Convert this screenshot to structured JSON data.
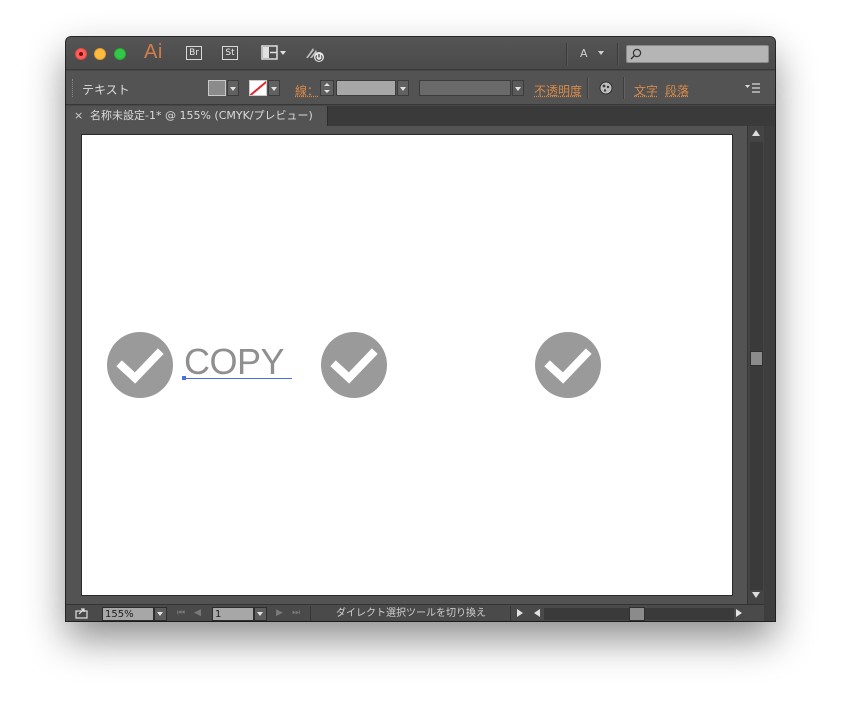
{
  "app": {
    "logo": "Ai",
    "bridge_label": "Br",
    "stock_label": "St",
    "workspace_label": "A",
    "search": {
      "value": "",
      "placeholder": ""
    }
  },
  "control_bar": {
    "selection_label": "テキスト",
    "stroke_label": "線：",
    "opacity_label": "不透明度",
    "character_label": "文字",
    "paragraph_label": "段落"
  },
  "document_tab": {
    "close_glyph": "×",
    "title": "名称未設定-1* @ 155% (CMYK/プレビュー)"
  },
  "artboard": {
    "copy_text": "COPY"
  },
  "status_bar": {
    "zoom": "155%",
    "page": "1",
    "status_text": "ダイレクト選択ツールを切り換え",
    "first_glyph": "⏮",
    "prev_glyph": "◀",
    "next_glyph": "▶",
    "last_glyph": "⏭"
  },
  "colors": {
    "accent_orange": "#d88a4a",
    "check_gray": "#9a9a9a",
    "selection_blue": "#4a6fe0"
  }
}
